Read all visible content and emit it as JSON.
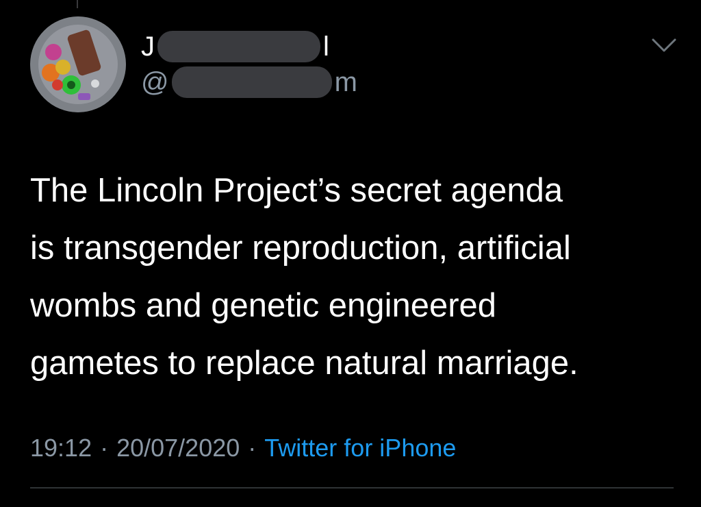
{
  "tweet": {
    "author": {
      "name_visible_prefix": "J",
      "name_visible_suffix": "l",
      "handle_prefix": "@",
      "handle_suffix": "m"
    },
    "text_lines": [
      "The Lincoln Project’s secret agenda",
      "is transgender reproduction, artificial",
      "wombs and genetic engineered",
      "gametes to replace natural marriage."
    ],
    "time": "19:12",
    "date": "20/07/2020",
    "separator": "·",
    "source": "Twitter for iPhone"
  },
  "icons": {
    "menu": "chevron-down-icon",
    "avatar": "avatar-image"
  },
  "colors": {
    "background": "#000000",
    "text": "#ffffff",
    "secondary_text": "#8b98a5",
    "link": "#1d9bf0",
    "redaction": "#3a3b3f"
  }
}
